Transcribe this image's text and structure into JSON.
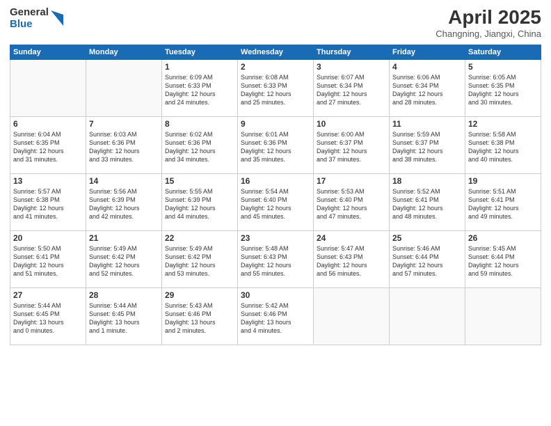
{
  "header": {
    "logo_general": "General",
    "logo_blue": "Blue",
    "month_title": "April 2025",
    "location": "Changning, Jiangxi, China"
  },
  "weekdays": [
    "Sunday",
    "Monday",
    "Tuesday",
    "Wednesday",
    "Thursday",
    "Friday",
    "Saturday"
  ],
  "weeks": [
    [
      {
        "day": "",
        "info": ""
      },
      {
        "day": "",
        "info": ""
      },
      {
        "day": "1",
        "info": "Sunrise: 6:09 AM\nSunset: 6:33 PM\nDaylight: 12 hours\nand 24 minutes."
      },
      {
        "day": "2",
        "info": "Sunrise: 6:08 AM\nSunset: 6:33 PM\nDaylight: 12 hours\nand 25 minutes."
      },
      {
        "day": "3",
        "info": "Sunrise: 6:07 AM\nSunset: 6:34 PM\nDaylight: 12 hours\nand 27 minutes."
      },
      {
        "day": "4",
        "info": "Sunrise: 6:06 AM\nSunset: 6:34 PM\nDaylight: 12 hours\nand 28 minutes."
      },
      {
        "day": "5",
        "info": "Sunrise: 6:05 AM\nSunset: 6:35 PM\nDaylight: 12 hours\nand 30 minutes."
      }
    ],
    [
      {
        "day": "6",
        "info": "Sunrise: 6:04 AM\nSunset: 6:35 PM\nDaylight: 12 hours\nand 31 minutes."
      },
      {
        "day": "7",
        "info": "Sunrise: 6:03 AM\nSunset: 6:36 PM\nDaylight: 12 hours\nand 33 minutes."
      },
      {
        "day": "8",
        "info": "Sunrise: 6:02 AM\nSunset: 6:36 PM\nDaylight: 12 hours\nand 34 minutes."
      },
      {
        "day": "9",
        "info": "Sunrise: 6:01 AM\nSunset: 6:36 PM\nDaylight: 12 hours\nand 35 minutes."
      },
      {
        "day": "10",
        "info": "Sunrise: 6:00 AM\nSunset: 6:37 PM\nDaylight: 12 hours\nand 37 minutes."
      },
      {
        "day": "11",
        "info": "Sunrise: 5:59 AM\nSunset: 6:37 PM\nDaylight: 12 hours\nand 38 minutes."
      },
      {
        "day": "12",
        "info": "Sunrise: 5:58 AM\nSunset: 6:38 PM\nDaylight: 12 hours\nand 40 minutes."
      }
    ],
    [
      {
        "day": "13",
        "info": "Sunrise: 5:57 AM\nSunset: 6:38 PM\nDaylight: 12 hours\nand 41 minutes."
      },
      {
        "day": "14",
        "info": "Sunrise: 5:56 AM\nSunset: 6:39 PM\nDaylight: 12 hours\nand 42 minutes."
      },
      {
        "day": "15",
        "info": "Sunrise: 5:55 AM\nSunset: 6:39 PM\nDaylight: 12 hours\nand 44 minutes."
      },
      {
        "day": "16",
        "info": "Sunrise: 5:54 AM\nSunset: 6:40 PM\nDaylight: 12 hours\nand 45 minutes."
      },
      {
        "day": "17",
        "info": "Sunrise: 5:53 AM\nSunset: 6:40 PM\nDaylight: 12 hours\nand 47 minutes."
      },
      {
        "day": "18",
        "info": "Sunrise: 5:52 AM\nSunset: 6:41 PM\nDaylight: 12 hours\nand 48 minutes."
      },
      {
        "day": "19",
        "info": "Sunrise: 5:51 AM\nSunset: 6:41 PM\nDaylight: 12 hours\nand 49 minutes."
      }
    ],
    [
      {
        "day": "20",
        "info": "Sunrise: 5:50 AM\nSunset: 6:41 PM\nDaylight: 12 hours\nand 51 minutes."
      },
      {
        "day": "21",
        "info": "Sunrise: 5:49 AM\nSunset: 6:42 PM\nDaylight: 12 hours\nand 52 minutes."
      },
      {
        "day": "22",
        "info": "Sunrise: 5:49 AM\nSunset: 6:42 PM\nDaylight: 12 hours\nand 53 minutes."
      },
      {
        "day": "23",
        "info": "Sunrise: 5:48 AM\nSunset: 6:43 PM\nDaylight: 12 hours\nand 55 minutes."
      },
      {
        "day": "24",
        "info": "Sunrise: 5:47 AM\nSunset: 6:43 PM\nDaylight: 12 hours\nand 56 minutes."
      },
      {
        "day": "25",
        "info": "Sunrise: 5:46 AM\nSunset: 6:44 PM\nDaylight: 12 hours\nand 57 minutes."
      },
      {
        "day": "26",
        "info": "Sunrise: 5:45 AM\nSunset: 6:44 PM\nDaylight: 12 hours\nand 59 minutes."
      }
    ],
    [
      {
        "day": "27",
        "info": "Sunrise: 5:44 AM\nSunset: 6:45 PM\nDaylight: 13 hours\nand 0 minutes."
      },
      {
        "day": "28",
        "info": "Sunrise: 5:44 AM\nSunset: 6:45 PM\nDaylight: 13 hours\nand 1 minute."
      },
      {
        "day": "29",
        "info": "Sunrise: 5:43 AM\nSunset: 6:46 PM\nDaylight: 13 hours\nand 2 minutes."
      },
      {
        "day": "30",
        "info": "Sunrise: 5:42 AM\nSunset: 6:46 PM\nDaylight: 13 hours\nand 4 minutes."
      },
      {
        "day": "",
        "info": ""
      },
      {
        "day": "",
        "info": ""
      },
      {
        "day": "",
        "info": ""
      }
    ]
  ]
}
